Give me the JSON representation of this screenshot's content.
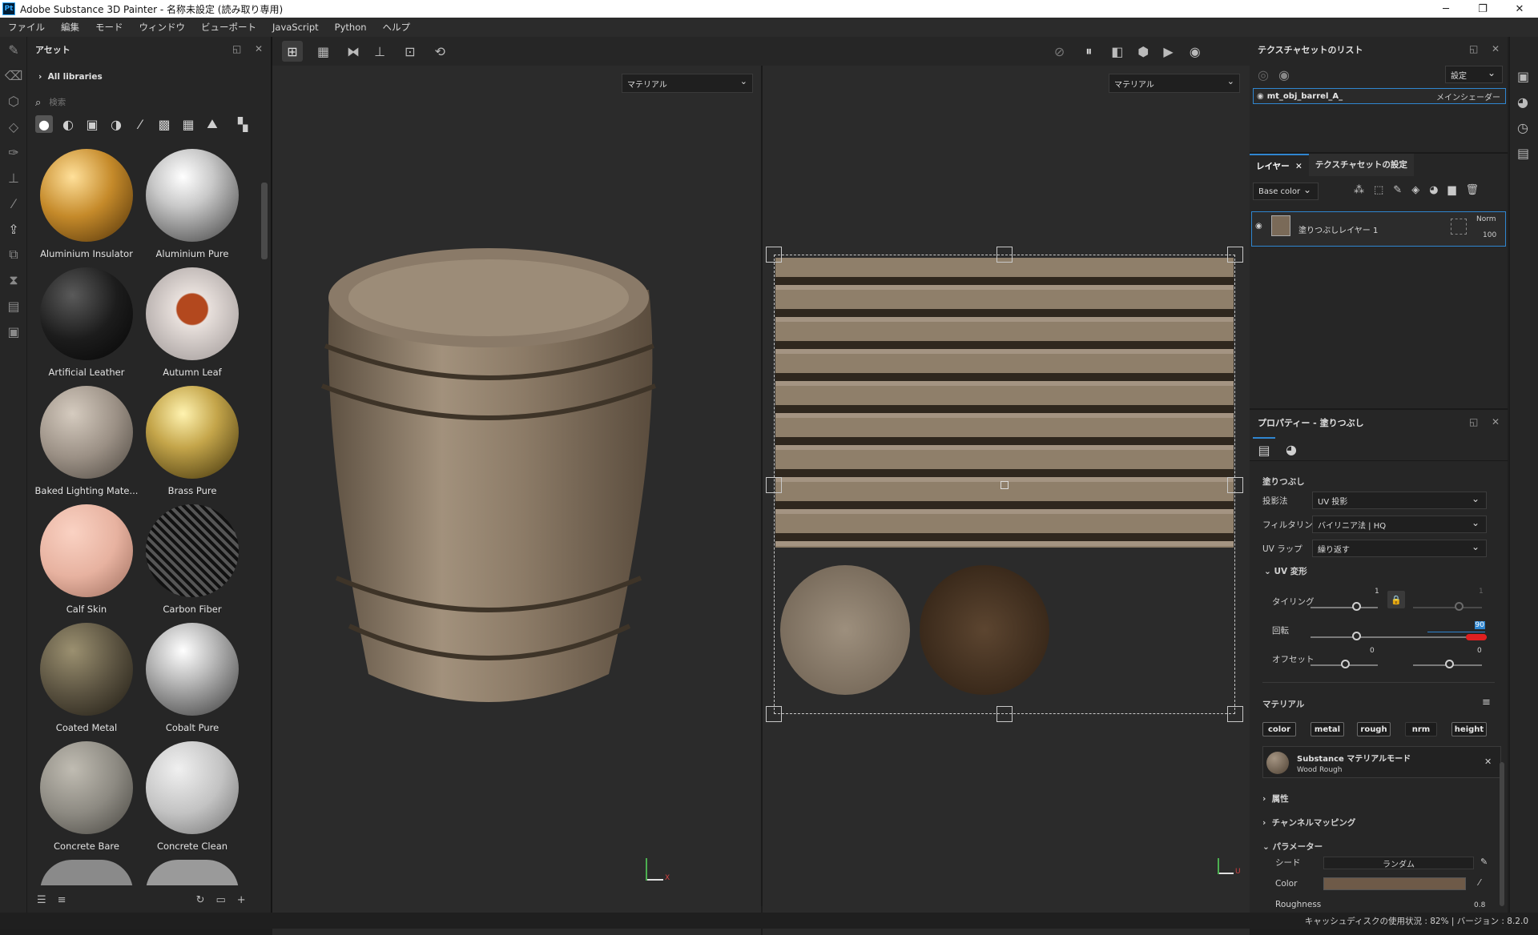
{
  "app": {
    "title": "Adobe Substance 3D Painter - 名称未設定 (読み取り専用)",
    "logo": "Pt"
  },
  "window_controls": {
    "minimize": "─",
    "maximize": "❐",
    "close": "✕"
  },
  "menu": [
    "ファイル",
    "編集",
    "モード",
    "ウィンドウ",
    "ビューポート",
    "JavaScript",
    "Python",
    "ヘルプ"
  ],
  "assets_panel": {
    "title": "アセット",
    "library": "All libraries",
    "search_placeholder": "検索",
    "items": [
      {
        "label": "Aluminium Insulator",
        "color": "#c58a2a"
      },
      {
        "label": "Aluminium Pure",
        "color": "#c9c9c9"
      },
      {
        "label": "Artificial Leather",
        "color": "#1c1c1c"
      },
      {
        "label": "Autumn Leaf",
        "color": "#e8e0dc"
      },
      {
        "label": "Baked Lighting Mate...",
        "color": "#9b9085"
      },
      {
        "label": "Brass Pure",
        "color": "#c4a54a"
      },
      {
        "label": "Calf Skin",
        "color": "#e7b2a0"
      },
      {
        "label": "Carbon Fiber",
        "color": "#2a2a2a"
      },
      {
        "label": "Coated Metal",
        "color": "#5a5240"
      },
      {
        "label": "Cobalt Pure",
        "color": "#bdbdbd"
      },
      {
        "label": "Concrete Bare",
        "color": "#8d8a82"
      },
      {
        "label": "Concrete Clean",
        "color": "#c3c3c3"
      }
    ]
  },
  "viewport": {
    "left_mode": "マテリアル",
    "right_mode": "マテリアル",
    "axis_3d": "X",
    "axis_uv": "U"
  },
  "texture_sets": {
    "title": "テクスチャセットのリスト",
    "settings_label": "設定",
    "item_name": "mt_obj_barrel_A_",
    "item_shader": "メインシェーダー"
  },
  "layers": {
    "tab_layers": "レイヤー",
    "tab_settings": "テクスチャセットの設定",
    "channel": "Base color",
    "layer_name": "塗りつぶしレイヤー 1",
    "blend": "Norm",
    "opacity": "100"
  },
  "properties": {
    "title": "プロパティー - 塗りつぶし",
    "section": "塗りつぶし",
    "projection_label": "投影法",
    "projection_value": "UV 投影",
    "filter_label": "フィルタリング",
    "filter_value": "バイリニア法 | HQ",
    "wrap_label": "UV ラップ",
    "wrap_value": "繰り返す",
    "uv_transform": "UV 変形",
    "tiling_label": "タイリング",
    "tiling_value": "1",
    "tiling_value2": "1",
    "rotation_label": "回転",
    "rotation_value": "90",
    "offset_label": "オフセット",
    "offset_value1": "0",
    "offset_value2": "0",
    "material_label": "マテリアル",
    "channels": [
      "color",
      "metal",
      "rough",
      "nrm",
      "height"
    ],
    "material_mode": "Substance マテリアルモード",
    "material_name": "Wood Rough",
    "attributes": "属性",
    "channel_mapping": "チャンネルマッピング",
    "parameters": "パラメーター",
    "seed_label": "シード",
    "seed_value": "ランダム",
    "color_label": "Color",
    "color_swatch": "#6e5a48",
    "roughness_label": "Roughness",
    "roughness_value": "0.8"
  },
  "status": {
    "text": "キャッシュディスクの使用状況 : 82% | バージョン : 8.2.0"
  }
}
